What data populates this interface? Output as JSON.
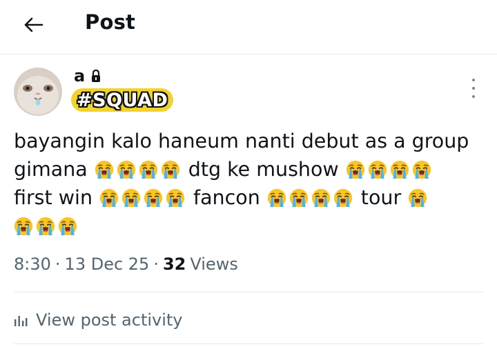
{
  "header": {
    "title": "Post",
    "back_icon": "arrow-left-icon"
  },
  "author": {
    "display_name": "a",
    "lock_icon": "lock-icon",
    "badge_text": "#SQUAD",
    "badge_color": "#f2d22e"
  },
  "post": {
    "line1": [
      "bayangin kalo haneum nanti debut as a group"
    ],
    "line2_a": "gimana",
    "line2_b": "dtg ke mushow",
    "line3_a": "first win",
    "line3_b": "fancon",
    "line3_c": "tour",
    "emoji": "loudly-crying-face-icon"
  },
  "meta": {
    "time": "8:30",
    "sep1": "·",
    "date": "13 Dec 25",
    "sep2": "·",
    "views_count": "32",
    "views_label": "Views"
  },
  "activity": {
    "label": "View post activity",
    "icon": "bar-chart-icon"
  },
  "colors": {
    "text": "#0f1419",
    "muted": "#536471",
    "divider": "#e6e9eb"
  }
}
